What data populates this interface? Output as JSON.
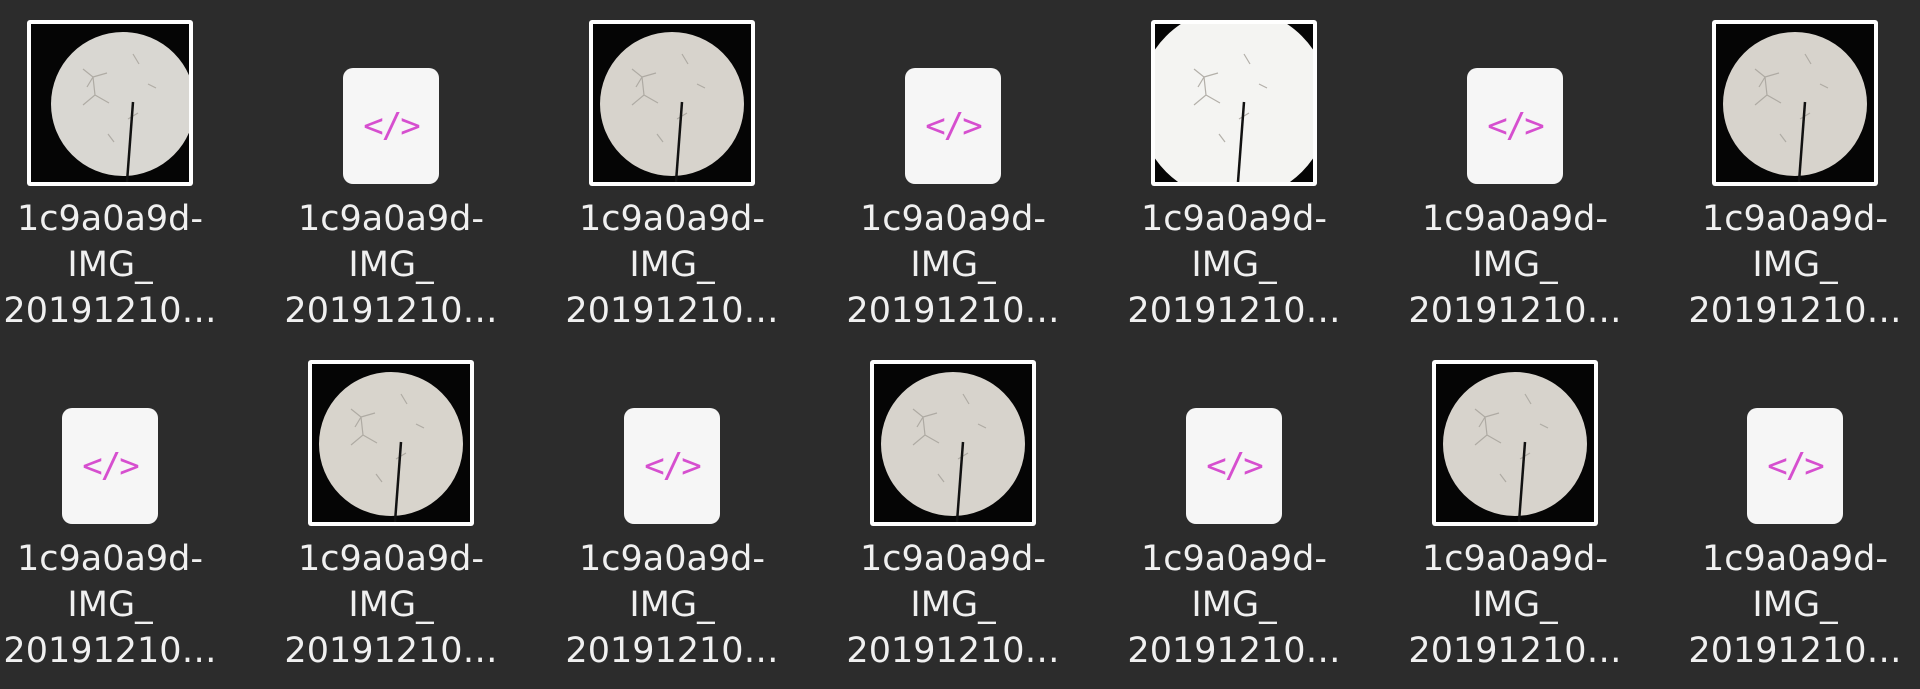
{
  "files": [
    {
      "type": "image",
      "line1": "1c9a0a9d-",
      "line2": "IMG_",
      "line3": "20191210…",
      "variant": "a"
    },
    {
      "type": "code",
      "line1": "1c9a0a9d-",
      "line2": "IMG_",
      "line3": "20191210…",
      "icon": "code-file-icon",
      "glyph": "</>"
    },
    {
      "type": "image",
      "line1": "1c9a0a9d-",
      "line2": "IMG_",
      "line3": "20191210…",
      "variant": "b"
    },
    {
      "type": "code",
      "line1": "1c9a0a9d-",
      "line2": "IMG_",
      "line3": "20191210…",
      "icon": "code-file-icon",
      "glyph": "</>"
    },
    {
      "type": "image",
      "line1": "1c9a0a9d-",
      "line2": "IMG_",
      "line3": "20191210…",
      "variant": "c"
    },
    {
      "type": "code",
      "line1": "1c9a0a9d-",
      "line2": "IMG_",
      "line3": "20191210…",
      "icon": "code-file-icon",
      "glyph": "</>"
    },
    {
      "type": "image",
      "line1": "1c9a0a9d-",
      "line2": "IMG_",
      "line3": "20191210…",
      "variant": "b"
    },
    {
      "type": "code",
      "line1": "1c9a0a9d-",
      "line2": "IMG_",
      "line3": "20191210…",
      "icon": "code-file-icon",
      "glyph": "</>"
    },
    {
      "type": "image",
      "line1": "1c9a0a9d-",
      "line2": "IMG_",
      "line3": "20191210…",
      "variant": "d"
    },
    {
      "type": "code",
      "line1": "1c9a0a9d-",
      "line2": "IMG_",
      "line3": "20191210…",
      "icon": "code-file-icon",
      "glyph": "</>"
    },
    {
      "type": "image",
      "line1": "1c9a0a9d-",
      "line2": "IMG_",
      "line3": "20191210…",
      "variant": "b"
    },
    {
      "type": "code",
      "line1": "1c9a0a9d-",
      "line2": "IMG_",
      "line3": "20191210…",
      "icon": "code-file-icon",
      "glyph": "</>"
    },
    {
      "type": "image",
      "line1": "1c9a0a9d-",
      "line2": "IMG_",
      "line3": "20191210…",
      "variant": "b"
    },
    {
      "type": "code",
      "line1": "1c9a0a9d-",
      "line2": "IMG_",
      "line3": "20191210…",
      "icon": "code-file-icon",
      "glyph": "</>"
    }
  ],
  "colors": {
    "background": "#2c2c2c",
    "label": "#f0f0f0",
    "code_glyph": "#d64fcf",
    "code_tile": "#f6f6f6"
  }
}
